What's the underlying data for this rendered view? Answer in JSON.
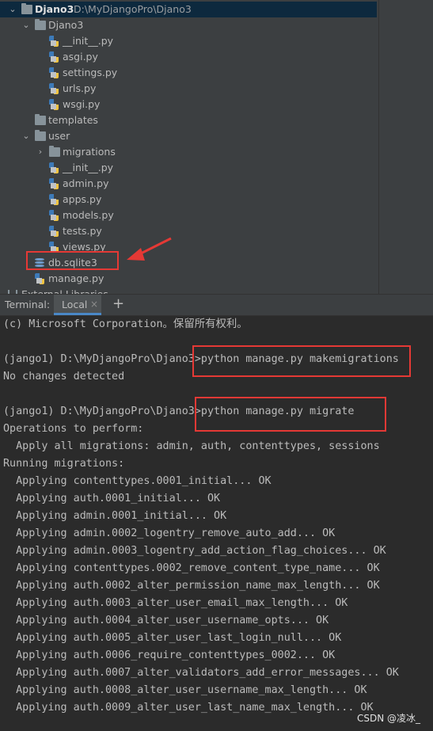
{
  "project_tree": {
    "root": {
      "name": "Djano3",
      "path": "D:\\MyDjangoPro\\Djano3"
    },
    "items": [
      {
        "label": "Djano3",
        "type": "folder",
        "expanded": true
      },
      {
        "label": "__init__.py",
        "type": "python-file"
      },
      {
        "label": "asgi.py",
        "type": "python-file"
      },
      {
        "label": "settings.py",
        "type": "python-file"
      },
      {
        "label": "urls.py",
        "type": "python-file"
      },
      {
        "label": "wsgi.py",
        "type": "python-file"
      },
      {
        "label": "templates",
        "type": "folder"
      },
      {
        "label": "user",
        "type": "folder",
        "expanded": true
      },
      {
        "label": "migrations",
        "type": "folder",
        "expanded": false
      },
      {
        "label": "__init__.py",
        "type": "python-file"
      },
      {
        "label": "admin.py",
        "type": "python-file"
      },
      {
        "label": "apps.py",
        "type": "python-file"
      },
      {
        "label": "models.py",
        "type": "python-file"
      },
      {
        "label": "tests.py",
        "type": "python-file"
      },
      {
        "label": "views.py",
        "type": "python-file"
      },
      {
        "label": "db.sqlite3",
        "type": "database-file"
      },
      {
        "label": "manage.py",
        "type": "python-file"
      },
      {
        "label": "External Libraries",
        "type": "library"
      }
    ]
  },
  "terminal": {
    "label": "Terminal:",
    "tab": "Local",
    "lines": [
      "(c) Microsoft Corporation。保留所有权利。",
      "",
      "(jango1) D:\\MyDjangoPro\\Djano3>python manage.py makemigrations",
      "No changes detected",
      "",
      "(jango1) D:\\MyDjangoPro\\Djano3>python manage.py migrate",
      "Operations to perform:",
      "  Apply all migrations: admin, auth, contenttypes, sessions",
      "Running migrations:",
      "  Applying contenttypes.0001_initial... OK",
      "  Applying auth.0001_initial... OK",
      "  Applying admin.0001_initial... OK",
      "  Applying admin.0002_logentry_remove_auto_add... OK",
      "  Applying admin.0003_logentry_add_action_flag_choices... OK",
      "  Applying contenttypes.0002_remove_content_type_name... OK",
      "  Applying auth.0002_alter_permission_name_max_length... OK",
      "  Applying auth.0003_alter_user_email_max_length... OK",
      "  Applying auth.0004_alter_user_username_opts... OK",
      "  Applying auth.0005_alter_user_last_login_null... OK",
      "  Applying auth.0006_require_contenttypes_0002... OK",
      "  Applying auth.0007_alter_validators_add_error_messages... OK",
      "  Applying auth.0008_alter_user_username_max_length... OK",
      "  Applying auth.0009_alter_user_last_name_max_length... OK"
    ]
  },
  "watermark": "CSDN @凌冰_",
  "colors": {
    "annotation": "#e53935",
    "selection": "#0d293e",
    "tab_accent": "#4a88c7"
  }
}
